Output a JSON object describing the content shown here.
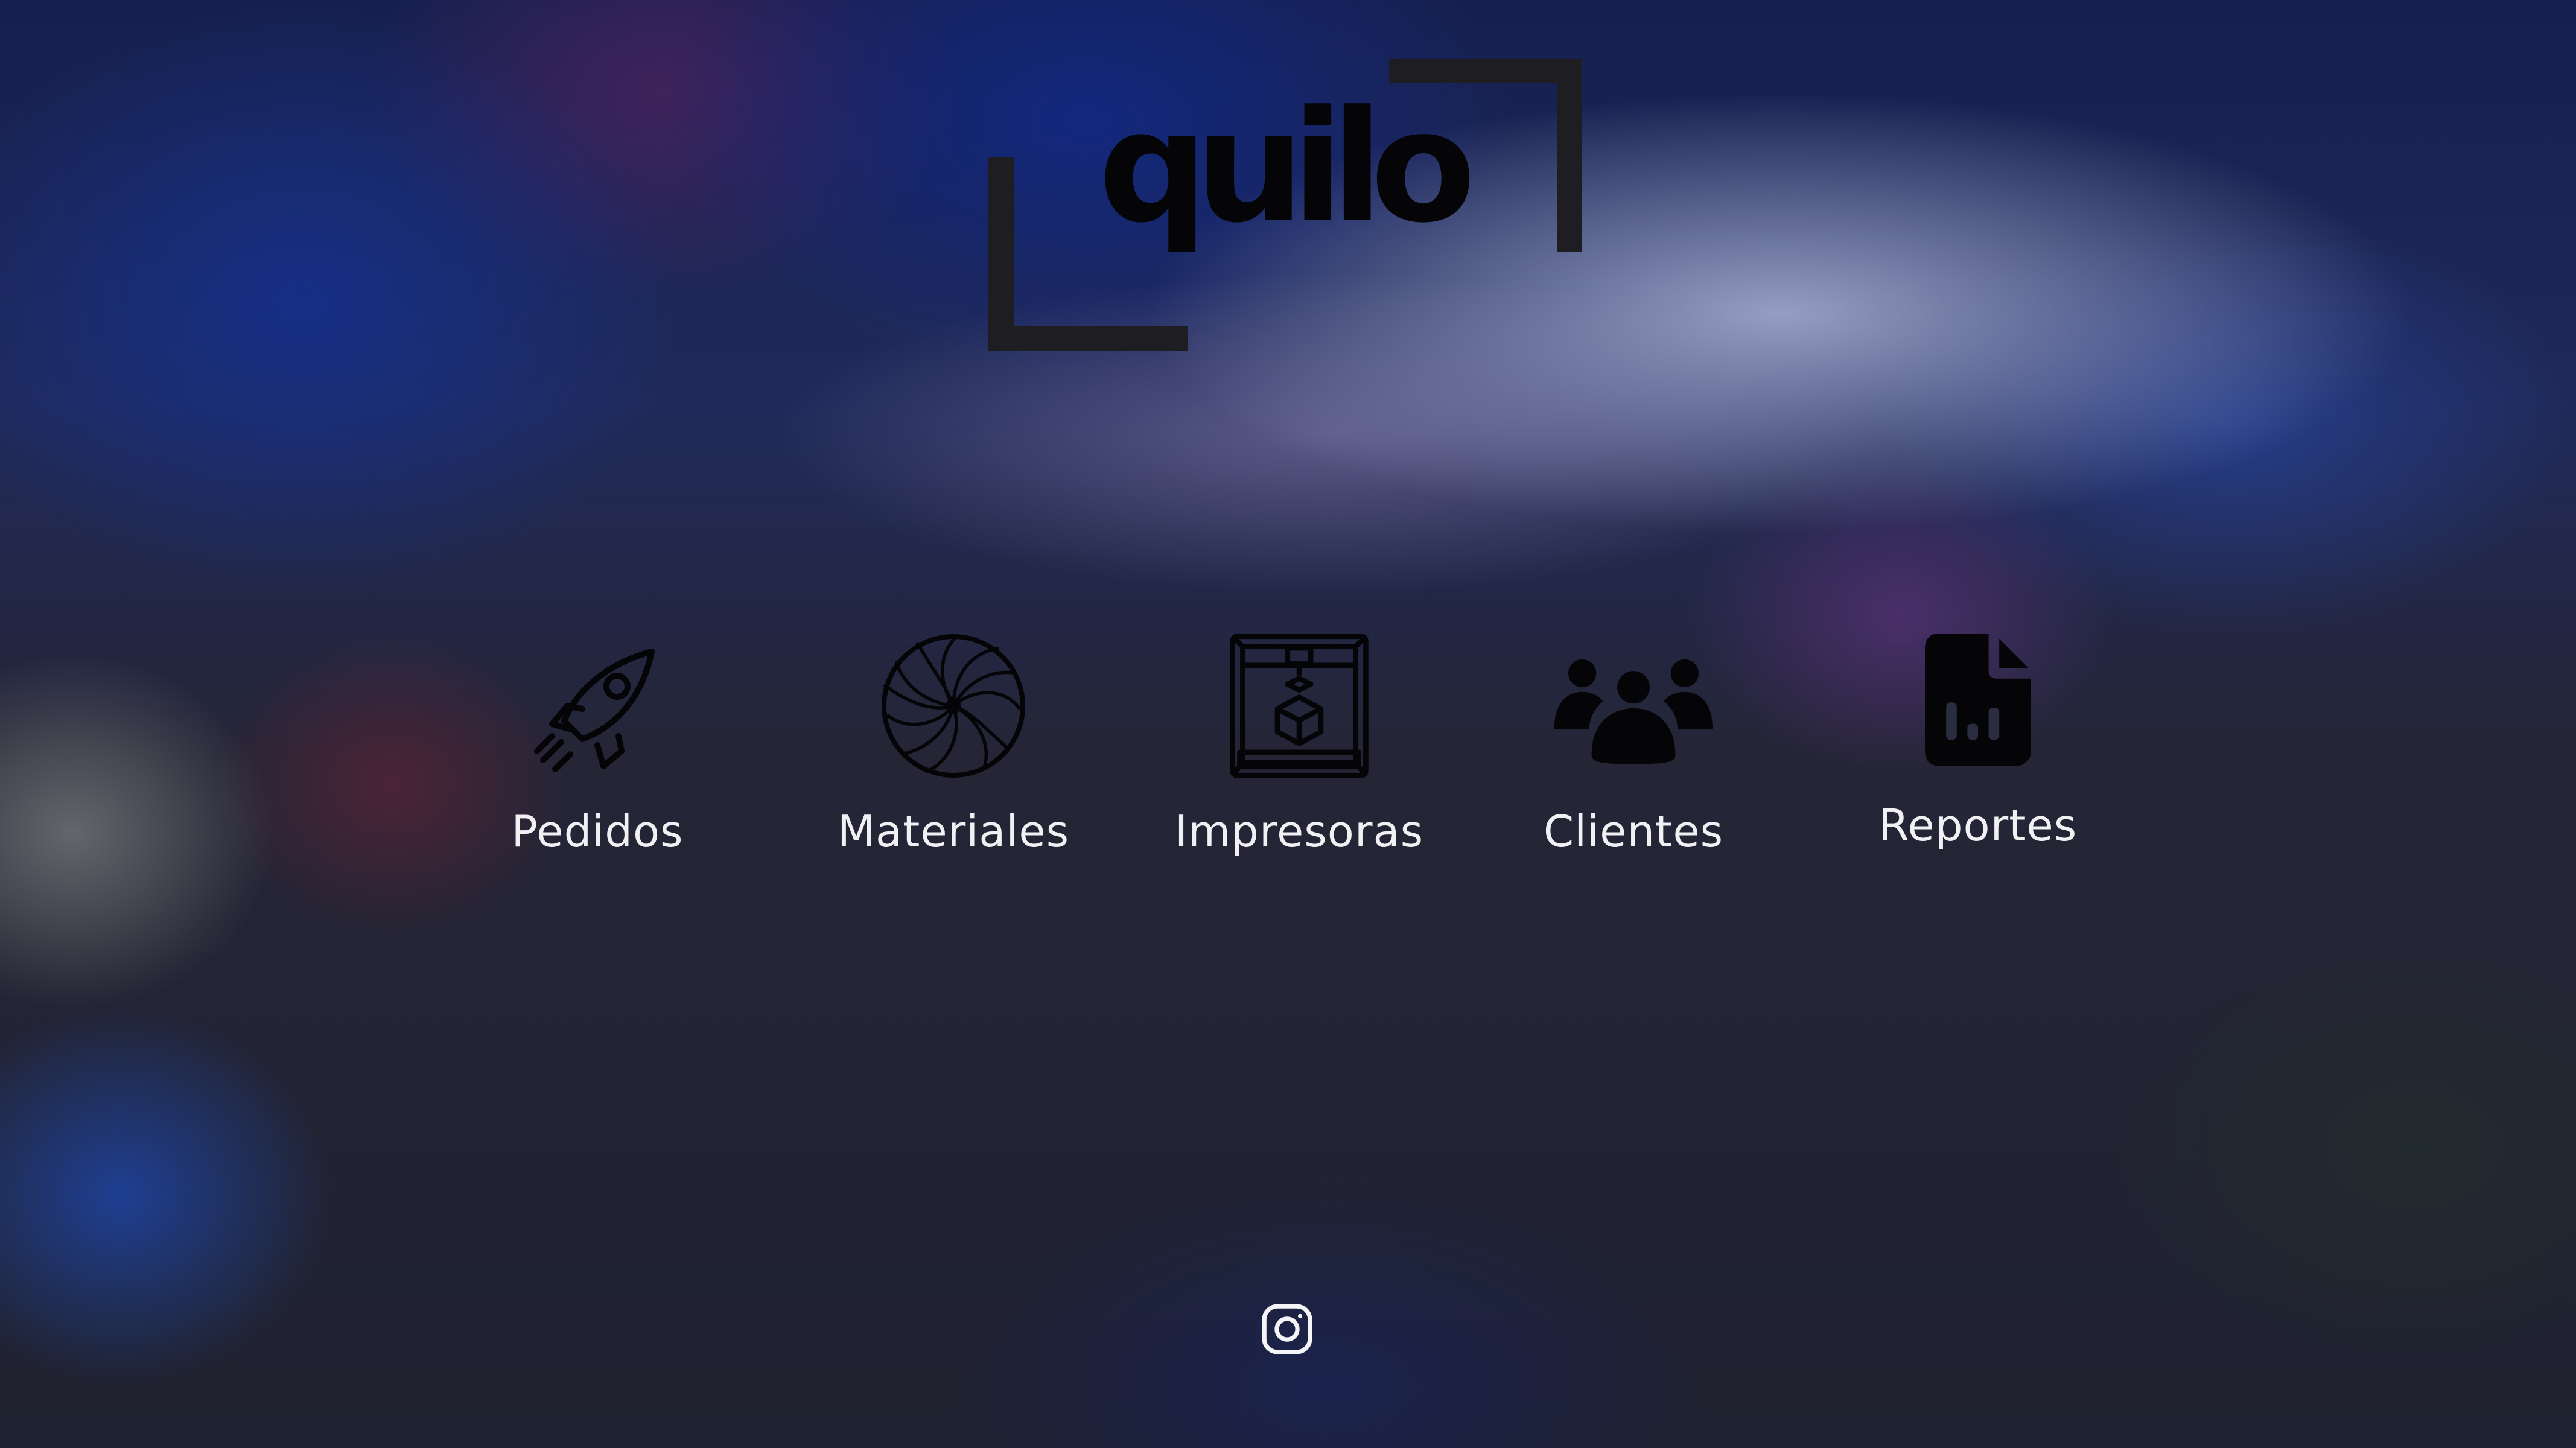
{
  "brand": {
    "logo_text": "quilo"
  },
  "nav": {
    "items": [
      {
        "label": "Pedidos",
        "icon": "rocket-icon"
      },
      {
        "label": "Materiales",
        "icon": "filament-spool-icon"
      },
      {
        "label": "Impresoras",
        "icon": "3d-printer-icon"
      },
      {
        "label": "Clientes",
        "icon": "users-group-icon"
      },
      {
        "label": "Reportes",
        "icon": "report-file-icon"
      }
    ]
  },
  "footer": {
    "social_icon": "instagram-icon"
  },
  "colors": {
    "icon": "#050508",
    "label": "#f1f1f4",
    "logo_bracket": "#1e1e22"
  }
}
